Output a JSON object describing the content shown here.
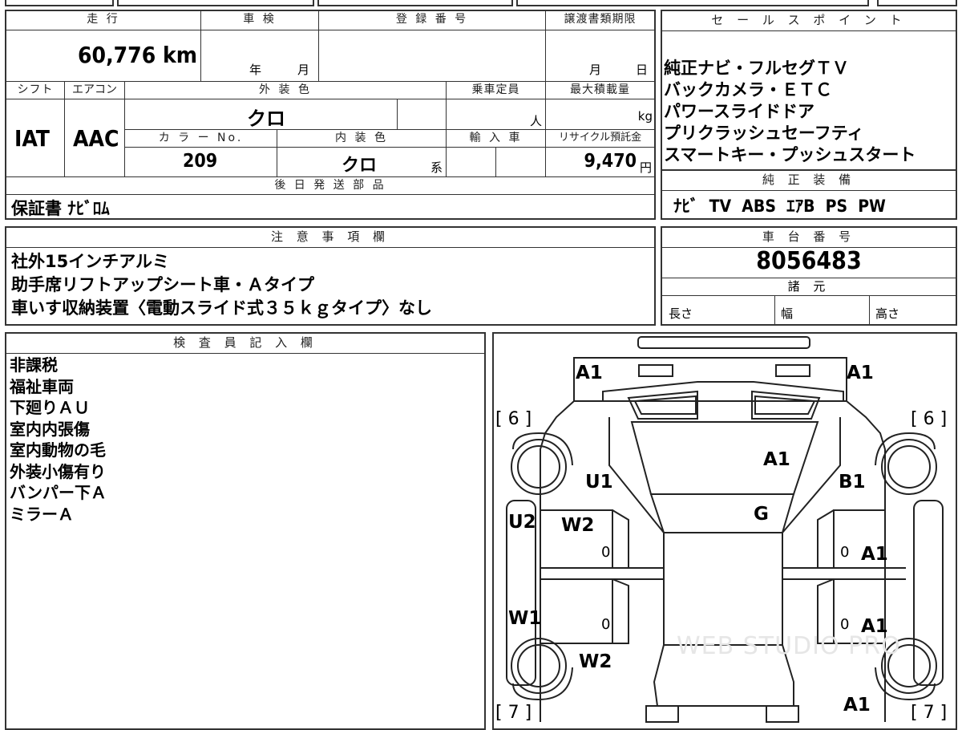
{
  "vehicle": {
    "mileage_label": "走 行",
    "mileage": "60,776 km",
    "inspection_label": "車 検",
    "inspection_year": "年",
    "inspection_month": "月",
    "registration_label": "登 録 番 号",
    "transfer_label": "譲渡書類期限",
    "transfer_month": "月",
    "transfer_day": "日",
    "shift_label": "シフト",
    "shift": "IAT",
    "ac_label": "エアコン",
    "ac": "AAC",
    "exterior_label": "外 装 色",
    "exterior_color": "クロ",
    "capacity_label": "乗車定員",
    "capacity_unit": "人",
    "maxload_label": "最大積載量",
    "maxload_unit": "kg",
    "color_no_label": "カ ラ ー No.",
    "color_no": "209",
    "interior_label": "内 装 色",
    "interior_color": "クロ",
    "interior_suffix": "系",
    "import_label": "輸 入 車",
    "recycle_label": "リサイクル預託金",
    "recycle_value": "9,470",
    "recycle_unit": "円",
    "later_parts_label": "後 日 発 送 部 品",
    "later_parts": "保証書 ﾅﾋﾞﾛﾑ"
  },
  "sales": {
    "label": "セ ー ル ス ポ イ ン ト",
    "points": [
      "純正ナビ・フルセグＴＶ",
      "バックカメラ・ＥＴＣ",
      "パワースライドドア",
      "プリクラッシュセーフティ",
      "スマートキー・プッシュスタート"
    ],
    "equipment_label": "純 正 装 備",
    "equipment": "ﾅﾋﾞ  TV  ABS  ｴｱB  PS  PW"
  },
  "notes": {
    "label": "注 意 事 項 欄",
    "lines": [
      "社外15インチアルミ",
      "助手席リフトアップシート車・Ａタイプ",
      "車いす収納装置〈電動スライド式３５ｋｇタイプ〉なし"
    ]
  },
  "chassis": {
    "label": "車 台 番 号",
    "number": "8056483",
    "spec_label": "諸 元",
    "length_label": "長さ",
    "width_label": "幅",
    "height_label": "高さ"
  },
  "inspector": {
    "label": "検 査 員 記 入 欄",
    "lines": [
      "非課税",
      "福祉車両",
      "下廻りＡＵ",
      "室内内張傷",
      "室内動物の毛",
      "外装小傷有り",
      "バンパー下Ａ",
      "ミラーＡ"
    ]
  },
  "diagram": {
    "marks": {
      "front_left": "A1",
      "front_right": "A1",
      "hood": "A1",
      "left_fender": "U1",
      "right_fender": "B1",
      "windshield": "G",
      "left_front_door_u": "U2",
      "left_front_door_w": "W2",
      "right_front_door": "A1",
      "left_sill": "W1",
      "left_rear_door": "W2",
      "right_rear_door": "A1",
      "rear_right": "A1",
      "tire_fl": "[ 6 ]",
      "tire_fr": "[ 6 ]",
      "tire_rl": "[ 7 ]",
      "tire_rr": "[ 7 ]",
      "zero": "0"
    },
    "watermark": "WEB STUDIO PRO"
  }
}
